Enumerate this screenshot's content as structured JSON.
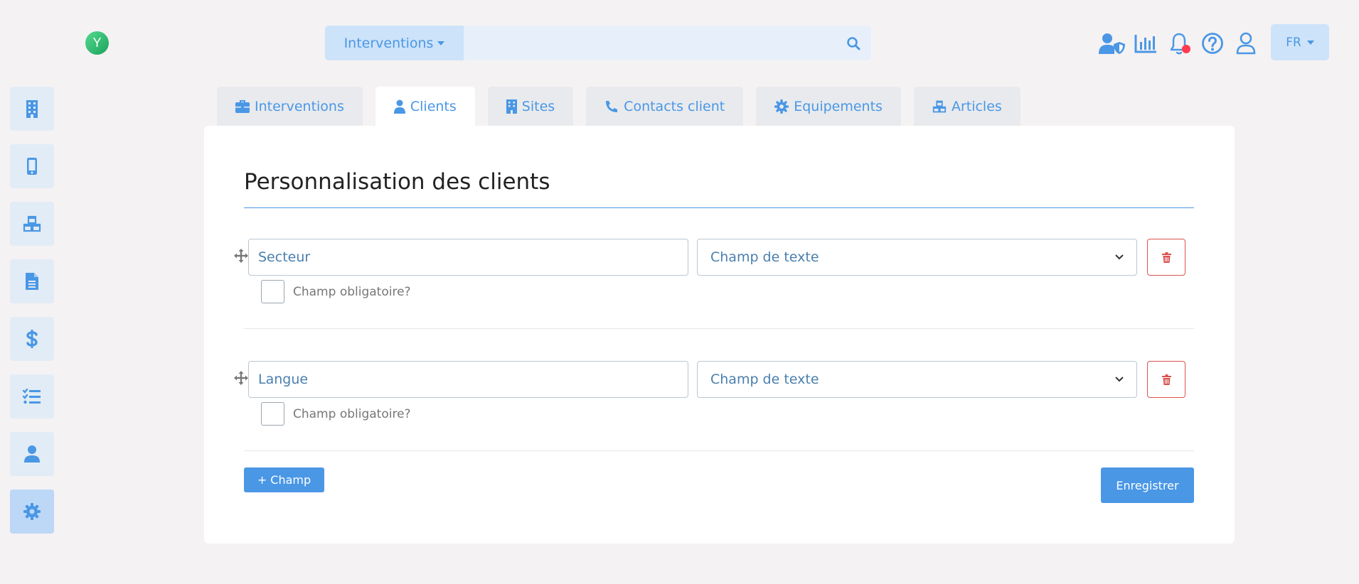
{
  "colors": {
    "accent": "#4a97e6",
    "danger": "#d9534f",
    "notification": "#ff3b4e",
    "logo": "#1aa35c"
  },
  "logo": {
    "letter": "Y"
  },
  "search": {
    "scope_label": "Interventions",
    "value": "",
    "placeholder": ""
  },
  "header_icons": [
    "user-shield-icon",
    "chart-icon",
    "bell-icon",
    "help-icon",
    "user-icon"
  ],
  "language": {
    "selected": "FR"
  },
  "sidebar": {
    "items": [
      {
        "icon": "building-icon",
        "active": false
      },
      {
        "icon": "mobile-icon",
        "active": false
      },
      {
        "icon": "cubes-icon",
        "active": false
      },
      {
        "icon": "file-icon",
        "active": false
      },
      {
        "icon": "dollar-icon",
        "active": false
      },
      {
        "icon": "tasks-icon",
        "active": false
      },
      {
        "icon": "user-icon",
        "active": false
      },
      {
        "icon": "gear-icon",
        "active": true
      }
    ]
  },
  "tabs": [
    {
      "label": "Interventions",
      "icon": "briefcase-icon",
      "active": false
    },
    {
      "label": "Clients",
      "icon": "user-icon",
      "active": true
    },
    {
      "label": "Sites",
      "icon": "building-icon",
      "active": false
    },
    {
      "label": "Contacts client",
      "icon": "phone-icon",
      "active": false
    },
    {
      "label": "Equipements",
      "icon": "gear-icon",
      "active": false
    },
    {
      "label": "Articles",
      "icon": "cubes-icon",
      "active": false
    }
  ],
  "card": {
    "title": "Personnalisation des clients",
    "fields": [
      {
        "name": "Secteur",
        "type": "Champ de texte",
        "required_label": "Champ obligatoire?",
        "required": false
      },
      {
        "name": "Langue",
        "type": "Champ de texte",
        "required_label": "Champ obligatoire?",
        "required": false
      }
    ],
    "add_label": "+ Champ",
    "save_label": "Enregistrer"
  }
}
